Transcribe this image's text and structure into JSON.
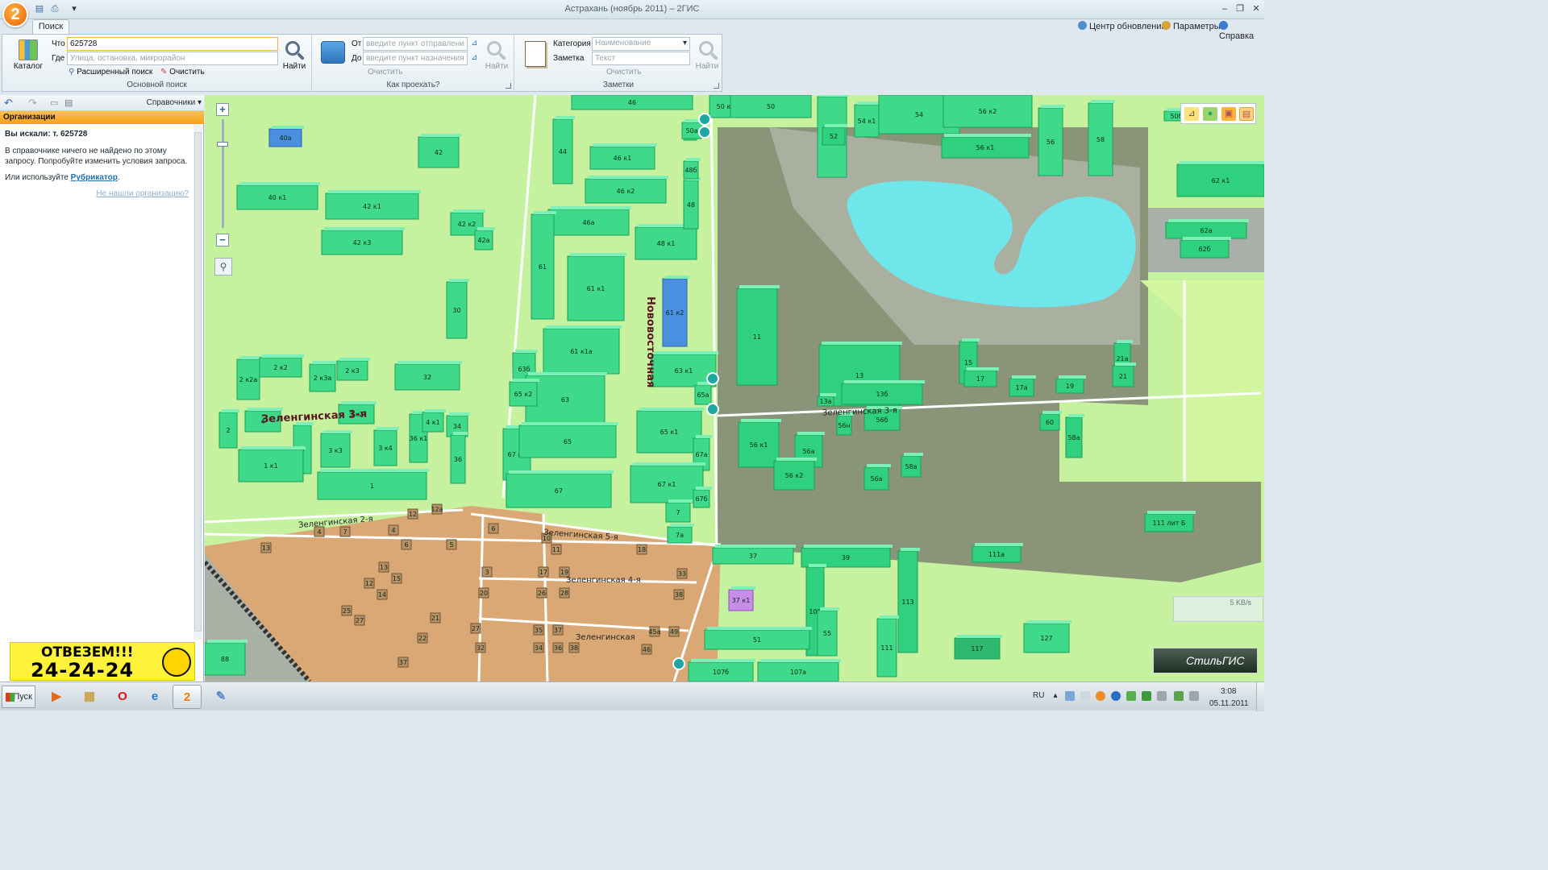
{
  "window": {
    "title": "Астрахань (ноябрь 2011) – 2ГИС",
    "app_logo": "2",
    "colors": {
      "accent": "#f07a12",
      "ribbon": "#e6eef3",
      "map_land": "#c6f2a0",
      "building": "#3fd98a",
      "private_sector": "#d9a874",
      "industrial": "#8a9478",
      "water": "#6fe6ea"
    }
  },
  "tabs": {
    "search": "Поиск"
  },
  "top_right": {
    "updates": "Центр обновлений",
    "params": "Параметры",
    "help": "Справка"
  },
  "ribbon": {
    "basic_search": {
      "catalog_label": "Каталог",
      "what_label": "Что",
      "what_value": "625728",
      "where_label": "Где",
      "where_placeholder": "Улица, остановка, микрорайон",
      "find_label": "Найти",
      "advanced": "Расширенный поиск",
      "clear": "Очистить",
      "group_title": "Основной поиск"
    },
    "route": {
      "from_label": "От",
      "from_placeholder": "введите пункт отправления",
      "to_label": "До",
      "to_placeholder": "введите пункт назначения",
      "find_label": "Найти",
      "clear": "Очистить",
      "group_title": "Как проехать?"
    },
    "notes": {
      "category_label": "Категория",
      "category_value": "Наименование",
      "note_label": "Заметка",
      "note_placeholder": "Текст",
      "find_label": "Найти",
      "clear": "Очистить",
      "group_title": "Заметки"
    }
  },
  "left_panel": {
    "directory_menu": "Справочники",
    "header": "Организации",
    "searched_label": "Вы искали: т. 625728",
    "not_found": "В справочнике ничего не найдено по этому запросу. Попробуйте изменить условия запроса.",
    "or_use": "Или используйте",
    "rubricator": "Рубрикатор",
    "not_found_link": "Не нашли организацию?",
    "banner_top": "ОТВЕЗЕМ!!!",
    "banner_phone": "24-24-24"
  },
  "map": {
    "streets": {
      "novovostochnaya": "Нововосточная",
      "zelenginskaya3_left": "Зеленгинская 3-я",
      "zelenginskaya3_right": "Зеленгинская 3-я",
      "zelenginskaya2": "Зеленгинская 2-я",
      "zelenginskaya5": "Зеленгинская 5-я",
      "zelenginskaya4": "Зеленгинская 4-я",
      "zelenginskaya": "Зеленгинская"
    },
    "speed": "5 KB/s",
    "brand": "СтильГИС",
    "buildings": [
      {
        "label": "40а"
      },
      {
        "label": "42"
      },
      {
        "label": "40 к1"
      },
      {
        "label": "42 к1"
      },
      {
        "label": "42 к2"
      },
      {
        "label": "42а"
      },
      {
        "label": "42 к3"
      },
      {
        "label": "30"
      },
      {
        "label": "32"
      },
      {
        "label": "2 к2а"
      },
      {
        "label": "2 к2"
      },
      {
        "label": "2 к3а"
      },
      {
        "label": "2 к3"
      },
      {
        "label": "3 к2"
      },
      {
        "label": "4"
      },
      {
        "label": "2"
      },
      {
        "label": "3"
      },
      {
        "label": "3 к3"
      },
      {
        "label": "3 к4"
      },
      {
        "label": "36 к1"
      },
      {
        "label": "4 к1"
      },
      {
        "label": "34"
      },
      {
        "label": "36"
      },
      {
        "label": "1 к1"
      },
      {
        "label": "1"
      },
      {
        "label": "44"
      },
      {
        "label": "46"
      },
      {
        "label": "46 к1"
      },
      {
        "label": "46 к2"
      },
      {
        "label": "46а"
      },
      {
        "label": "48 к1"
      },
      {
        "label": "48"
      },
      {
        "label": "48б"
      },
      {
        "label": "48а"
      },
      {
        "label": "61"
      },
      {
        "label": "61 к1"
      },
      {
        "label": "61 к2"
      },
      {
        "label": "61 к1а"
      },
      {
        "label": "63б"
      },
      {
        "label": "63"
      },
      {
        "label": "65 к2"
      },
      {
        "label": "63 к1"
      },
      {
        "label": "65а"
      },
      {
        "label": "65 к1"
      },
      {
        "label": "67 к2"
      },
      {
        "label": "65"
      },
      {
        "label": "67а"
      },
      {
        "label": "67 к1"
      },
      {
        "label": "67"
      },
      {
        "label": "67б"
      },
      {
        "label": "7"
      },
      {
        "label": "7а"
      },
      {
        "label": "50 к1"
      },
      {
        "label": "50а"
      },
      {
        "label": "50"
      },
      {
        "label": "52а"
      },
      {
        "label": "52"
      },
      {
        "label": "54 к1"
      },
      {
        "label": "54"
      },
      {
        "label": "56 к2"
      },
      {
        "label": "56 к1"
      },
      {
        "label": "56"
      },
      {
        "label": "58"
      },
      {
        "label": "62 к1"
      },
      {
        "label": "62а"
      },
      {
        "label": "62б"
      },
      {
        "label": "50б"
      },
      {
        "label": "11"
      },
      {
        "label": "13"
      },
      {
        "label": "13а"
      },
      {
        "label": "13б"
      },
      {
        "label": "15"
      },
      {
        "label": "17"
      },
      {
        "label": "17а"
      },
      {
        "label": "19"
      },
      {
        "label": "21а"
      },
      {
        "label": "21"
      },
      {
        "label": "56а"
      },
      {
        "label": "56н"
      },
      {
        "label": "56б"
      },
      {
        "label": "58а"
      },
      {
        "label": "60"
      },
      {
        "label": "56 к1"
      },
      {
        "label": "56 к2"
      },
      {
        "label": "58а"
      },
      {
        "label": "56а"
      },
      {
        "label": "111 лит Б"
      },
      {
        "label": "111а"
      },
      {
        "label": "37"
      },
      {
        "label": "39"
      },
      {
        "label": "37 к1"
      },
      {
        "label": "109"
      },
      {
        "label": "113"
      },
      {
        "label": "51"
      },
      {
        "label": "55"
      },
      {
        "label": "111"
      },
      {
        "label": "107б"
      },
      {
        "label": "107а"
      },
      {
        "label": "117"
      },
      {
        "label": "127"
      },
      {
        "label": "88"
      }
    ],
    "houses": [
      {
        "label": "12"
      },
      {
        "label": "12а"
      },
      {
        "label": "4"
      },
      {
        "label": "7"
      },
      {
        "label": "4"
      },
      {
        "label": "6"
      },
      {
        "label": "5"
      },
      {
        "label": "13"
      },
      {
        "label": "13"
      },
      {
        "label": "12"
      },
      {
        "label": "15"
      },
      {
        "label": "14"
      },
      {
        "label": "25"
      },
      {
        "label": "27"
      },
      {
        "label": "21"
      },
      {
        "label": "22"
      },
      {
        "label": "37"
      },
      {
        "label": "6"
      },
      {
        "label": "10"
      },
      {
        "label": "11"
      },
      {
        "label": "18"
      },
      {
        "label": "3"
      },
      {
        "label": "17"
      },
      {
        "label": "19"
      },
      {
        "label": "33"
      },
      {
        "label": "20"
      },
      {
        "label": "26"
      },
      {
        "label": "28"
      },
      {
        "label": "38"
      },
      {
        "label": "27"
      },
      {
        "label": "35"
      },
      {
        "label": "37"
      },
      {
        "label": "45а"
      },
      {
        "label": "49"
      },
      {
        "label": "32"
      },
      {
        "label": "34"
      },
      {
        "label": "36"
      },
      {
        "label": "38"
      },
      {
        "label": "46"
      }
    ]
  },
  "taskbar": {
    "start": "Пуск",
    "lang": "RU",
    "time": "3:08",
    "date": "05.11.2011"
  }
}
